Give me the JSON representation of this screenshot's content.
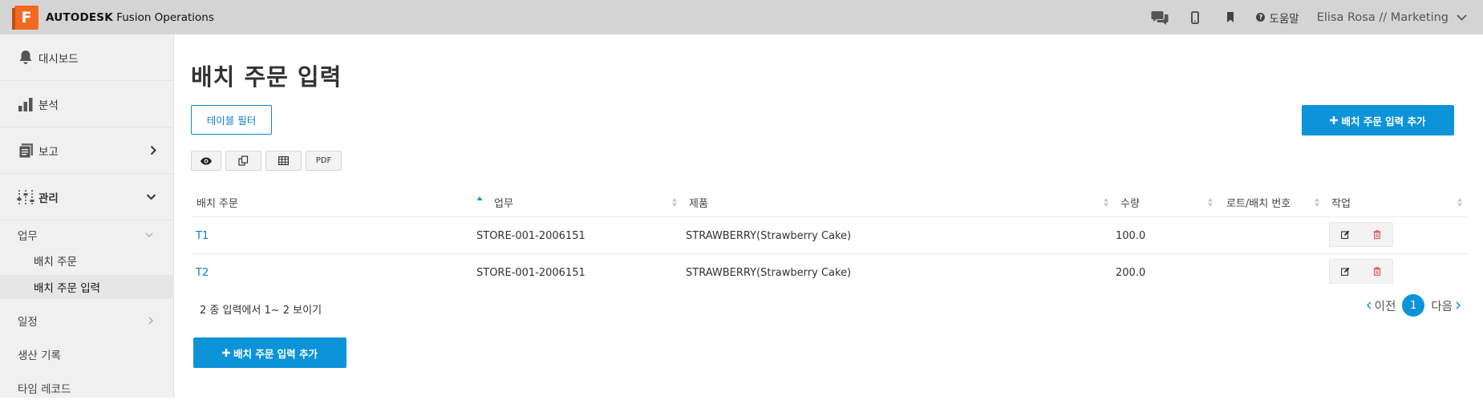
{
  "app": {
    "logo_letter": "F",
    "brand_bold": "AUTODESK",
    "brand_rest": " Fusion Operations"
  },
  "topbar": {
    "help_label": "도움말",
    "user_label": "Elisa Rosa // Marketing"
  },
  "sidebar": {
    "main_items": [
      {
        "label": "대시보드",
        "icon": "bell-icon"
      },
      {
        "label": "분석",
        "icon": "bar-chart-icon"
      },
      {
        "label": "보고",
        "icon": "report-icon"
      },
      {
        "label": "관리",
        "icon": "sliders-icon"
      }
    ],
    "sub_items": [
      {
        "label": "업무"
      },
      {
        "label": "일정"
      },
      {
        "label": "생산 기록"
      },
      {
        "label": "타임 레코드"
      }
    ],
    "leaf_items": [
      {
        "label": "배치 주문"
      },
      {
        "label": "배치 주문 입력"
      }
    ]
  },
  "page": {
    "title": "배치 주문 입력",
    "filter_button": "테이블 필터",
    "add_button": "배치 주문 입력 추가",
    "pdf_label": "PDF",
    "columns": [
      "배치 주문",
      "업무",
      "제품",
      "수량",
      "로트/배치 번호",
      "작업"
    ],
    "rows": [
      {
        "order": "T1",
        "job": "STORE-001-2006151",
        "product": "STRAWBERRY(Strawberry Cake)",
        "qty": "100.0",
        "lot": ""
      },
      {
        "order": "T2",
        "job": "STORE-001-2006151",
        "product": "STRAWBERRY(Strawberry Cake)",
        "qty": "200.0",
        "lot": ""
      }
    ],
    "summary": "2 종 입력에서 1~ 2 보이기",
    "pager": {
      "prev": "이전",
      "current": "1",
      "next": "다음"
    }
  },
  "colors": {
    "accent": "#0d93d8",
    "topbar": "#d4d4d4",
    "sidebar": "#f0f0f0",
    "logo": "#f26a21",
    "delete": "#e05555"
  }
}
